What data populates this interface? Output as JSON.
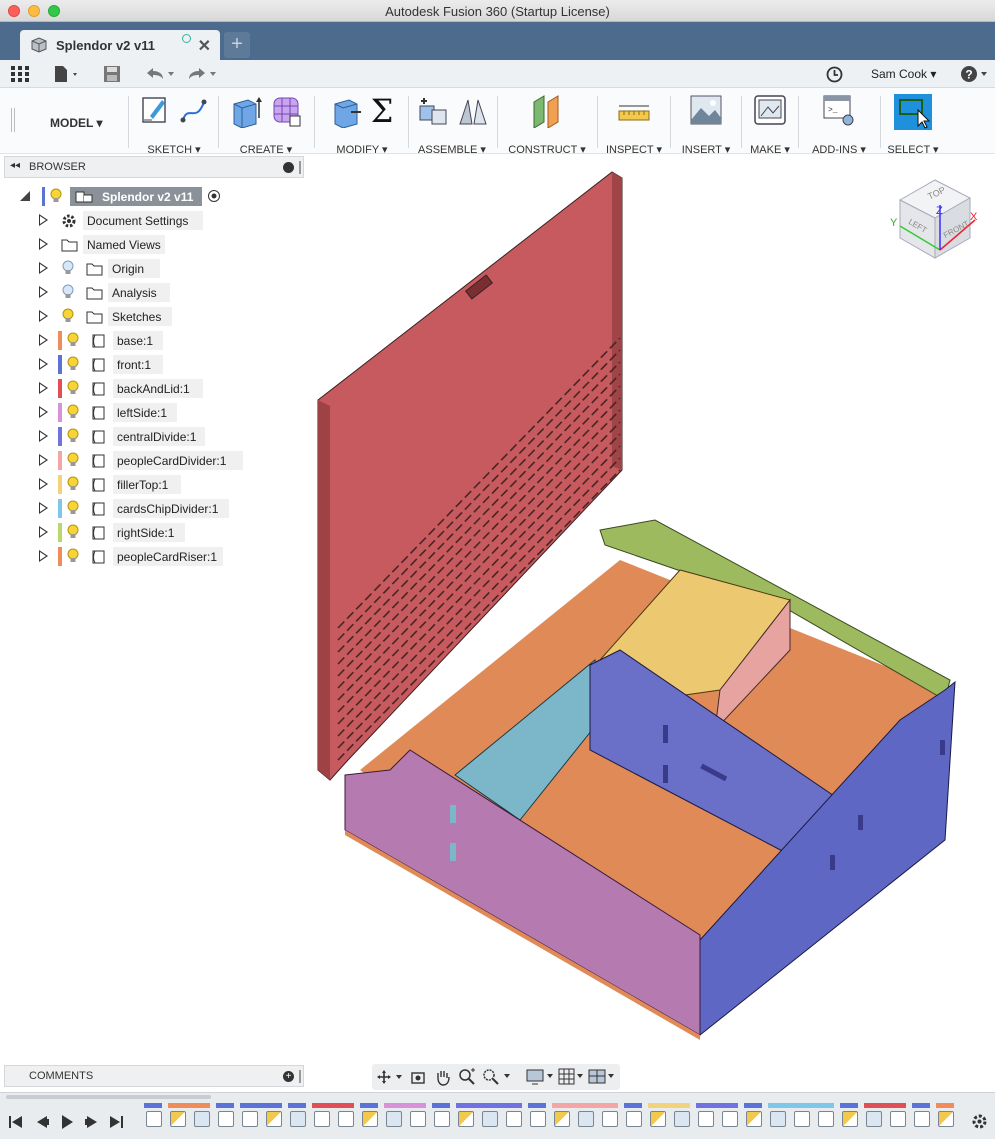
{
  "window": {
    "title": "Autodesk Fusion 360 (Startup License)"
  },
  "tab": {
    "label": "Splendor v2 v11",
    "close": "✕",
    "new_tab": "+"
  },
  "qat": {
    "user": "Sam Cook ▾",
    "help": "?▾"
  },
  "toolbar": {
    "workspace": "MODEL ▾",
    "groups": [
      "SKETCH ▾",
      "CREATE ▾",
      "MODIFY ▾",
      "ASSEMBLE ▾",
      "CONSTRUCT ▾",
      "INSPECT ▾",
      "INSERT ▾",
      "MAKE ▾",
      "ADD-INS ▾",
      "SELECT ▾"
    ],
    "modify_sigma": "Σ"
  },
  "browser": {
    "title": "BROWSER",
    "root": "Splendor v2 v11",
    "items": [
      {
        "label": "Document Settings",
        "icon": "gear-icon"
      },
      {
        "label": "Named Views",
        "icon": "folder-icon"
      },
      {
        "label": "Origin",
        "icon": "folder-icon"
      },
      {
        "label": "Analysis",
        "icon": "folder-icon"
      },
      {
        "label": "Sketches",
        "icon": "folder-icon"
      },
      {
        "label": "base:1",
        "color": "#f08c5a"
      },
      {
        "label": "front:1",
        "color": "#5b72d6"
      },
      {
        "label": "backAndLid:1",
        "color": "#e04f55"
      },
      {
        "label": "leftSide:1",
        "color": "#d991d9"
      },
      {
        "label": "centralDivide:1",
        "color": "#6f72e0"
      },
      {
        "label": "peopleCardDivider:1",
        "color": "#f4a6a6"
      },
      {
        "label": "fillerTop:1",
        "color": "#f2d27a"
      },
      {
        "label": "cardsChipDivider:1",
        "color": "#7fc7e8"
      },
      {
        "label": "rightSide:1",
        "color": "#b5d96a"
      },
      {
        "label": "peopleCardRiser:1",
        "color": "#f08c5a"
      }
    ]
  },
  "comments": {
    "title": "COMMENTS"
  },
  "viewcube": {
    "top": "TOP",
    "left": "LEFT",
    "front": "FRONT",
    "x": "X",
    "y": "Y",
    "z": "Z"
  },
  "colors": {
    "lid": "#c55a5d",
    "base": "#e28a55",
    "front": "#6a6fc8",
    "leftSide": "#b57bb0",
    "rightSide": "#9dbb5e",
    "filler": "#ecc971",
    "cardsChip": "#7cb6c9",
    "peopleCard": "#e7a3a0"
  }
}
